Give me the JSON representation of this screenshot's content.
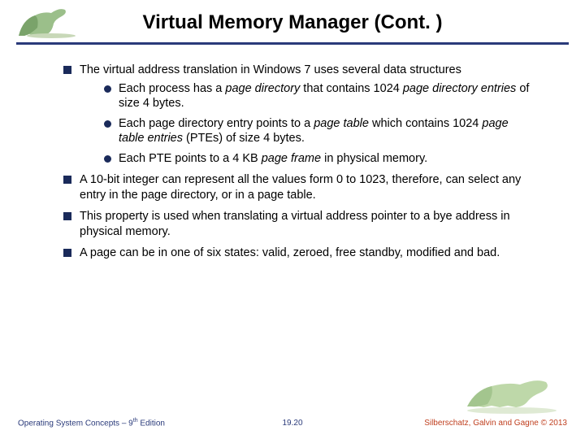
{
  "title": "Virtual Memory Manager (Cont. )",
  "bullets": {
    "b1": "The virtual address translation in Windows 7 uses several data structures",
    "b1s1a": "Each process has a ",
    "b1s1b": "page directory",
    "b1s1c": " that contains 1024 ",
    "b1s1d": "page directory entries",
    "b1s1e": " of size 4 bytes.",
    "b1s2a": "Each page directory entry points to a ",
    "b1s2b": "page table",
    "b1s2c": " which contains 1024 ",
    "b1s2d": "page table entries",
    "b1s2e": " (PTEs) of size 4 bytes.",
    "b1s3a": "Each PTE points to a 4 KB ",
    "b1s3b": "page frame",
    "b1s3c": " in physical memory.",
    "b2": "A 10-bit integer can represent all the values form 0 to 1023, therefore, can select any entry in the page directory, or in a page table.",
    "b3": "This property is used when translating a virtual address pointer to a bye address in physical memory.",
    "b4": "A page can be in one of six states: valid, zeroed, free standby, modified and bad."
  },
  "footer": {
    "left_a": "Operating System Concepts – 9",
    "left_b": "th",
    "left_c": " Edition",
    "center": "19.20",
    "right": "Silberschatz, Galvin and Gagne © 2013"
  }
}
